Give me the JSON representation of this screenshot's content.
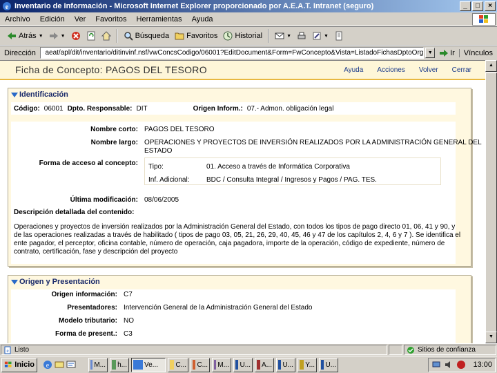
{
  "window": {
    "title": "Inventario de Información - Microsoft Internet Explorer proporcionado por A.E.A.T. Intranet (seguro)",
    "minimize": "_",
    "maximize": "□",
    "close": "×"
  },
  "menu": [
    "Archivo",
    "Edición",
    "Ver",
    "Favoritos",
    "Herramientas",
    "Ayuda"
  ],
  "toolbar": {
    "back": "Atrás",
    "search": "Búsqueda",
    "favorites": "Favoritos",
    "history": "Historial"
  },
  "address": {
    "label": "Dirección",
    "url": "aeat/apl/dit/inventario/ditinvinf.nsf/vwConcsCodigo/06001?EditDocument&Form=FwConcepto&Vista=ListadoFichasDptoOrg",
    "go": "Ir",
    "links": "Vínculos"
  },
  "page": {
    "title_part1": "Ficha de Concepto: ",
    "title_part2": "PAGOS DEL TESORO",
    "links": [
      "Ayuda",
      "Acciones",
      "Volver",
      "Cerrar"
    ]
  },
  "identificacion": {
    "heading": "Identificación",
    "codigo_label": "Código:",
    "codigo": "06001",
    "dpto_label": "Dpto. Responsable:",
    "dpto": "DIT",
    "origen_label": "Origen Inform.:",
    "origen": "07.- Admon. obligación legal",
    "nombre_corto_label": "Nombre corto:",
    "nombre_corto": "PAGOS DEL TESORO",
    "nombre_largo_label": "Nombre largo:",
    "nombre_largo_1": "OPERACIONES Y PROYECTOS DE INVERSIÓN REALIZADOS POR LA ADMINISTRACIÓN GENERAL DEL",
    "nombre_largo_2": "ESTADO",
    "forma_acceso_label": "Forma de acceso al concepto:",
    "tipo_label": "Tipo:",
    "tipo": "01. Acceso a través de Informática Corporativa",
    "inf_label": "Inf. Adicional:",
    "inf": "BDC / Consulta Integral / Ingresos y Pagos / PAG. TES.",
    "ultima_label": "Última modificación:",
    "ultima": "08/06/2005",
    "descripcion_label": "Descripción detallada del contenido:",
    "descripcion_1": "Operaciones y proyectos de inversión realizados por la Administración General del Estado, con todos los tipos de pago directo 01, 06, 41 y 90, y",
    "descripcion_2": "de las operaciones realizadas a través de habilitado ( tipos de pago 03, 05, 21, 26, 29, 40, 45, 46 y 47 de los capítulos 2, 4, 6 y 7 ). Se identifica el",
    "descripcion_3": "ente pagador, el perceptor, oficina contable, número de operación, caja pagadora, importe de la operación, código de expediente, número de",
    "descripcion_4": "contrato, certificación, fase y descripción del proyecto"
  },
  "origen_presentacion": {
    "heading": "Origen y Presentación",
    "origen_label": "Origen información:",
    "origen": "C7",
    "presentadores_label": "Presentadores:",
    "presentadores": "Intervención General de la Administración General del Estado",
    "modelo_label": "Modelo tributario:",
    "modelo": "NO",
    "forma_label": "Forma de present.:",
    "forma": "C3"
  },
  "status": {
    "text": "Listo",
    "zone": "Sitios de confianza"
  },
  "taskbar": {
    "start": "Inicio",
    "tasks": [
      "M...",
      "h...",
      "Ve...",
      "C...",
      "C...",
      "M...",
      "U...",
      "A...",
      "U...",
      "Y...",
      "U..."
    ],
    "clock": "13:00"
  },
  "colors": {
    "titlebar": "#0a246a",
    "header_bg": "#fef6d8",
    "section_bg": "#fff8e0",
    "accent": "#c07000",
    "link": "#1a3a8a"
  }
}
